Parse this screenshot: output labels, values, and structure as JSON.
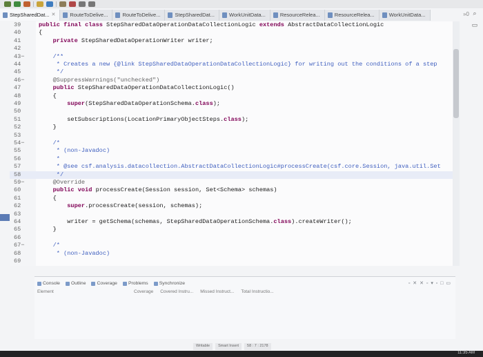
{
  "tabs": [
    {
      "label": "StepSharedDat...",
      "active": true
    },
    {
      "label": "RouteToDelive..."
    },
    {
      "label": "RouteToDelive..."
    },
    {
      "label": "StepSharedDat..."
    },
    {
      "label": "WorkUnitData..."
    },
    {
      "label": "ResourceRelea..."
    },
    {
      "label": "ResourceRelea..."
    },
    {
      "label": "WorkUnitData..."
    }
  ],
  "tabs_overflow": "»0",
  "code_lines": [
    {
      "num": "39",
      "text": "public final class StepSharedDataOperationDataCollectionLogic extends AbstractDataCollectionLogic"
    },
    {
      "num": "40",
      "text": "{"
    },
    {
      "num": "41",
      "text": "    private StepSharedDataOperationWriter writer;"
    },
    {
      "num": "42",
      "text": ""
    },
    {
      "num": "43−",
      "text": "    /**"
    },
    {
      "num": "44",
      "text": "     * Creates a new {@link StepSharedDataOperationDataCollectionLogic} for writing out the conditions of a step"
    },
    {
      "num": "45",
      "text": "     */"
    },
    {
      "num": "46−",
      "text": "    @SuppressWarnings(\"unchecked\")"
    },
    {
      "num": "47",
      "text": "    public StepSharedDataOperationDataCollectionLogic()"
    },
    {
      "num": "48",
      "text": "    {"
    },
    {
      "num": "49",
      "text": "        super(StepSharedDataOperationSchema.class);"
    },
    {
      "num": "50",
      "text": ""
    },
    {
      "num": "51",
      "text": "        setSubscriptions(LocationPrimaryObjectSteps.class);"
    },
    {
      "num": "52",
      "text": "    }"
    },
    {
      "num": "53",
      "text": ""
    },
    {
      "num": "54−",
      "text": "    /*"
    },
    {
      "num": "55",
      "text": "     * (non-Javadoc)"
    },
    {
      "num": "56",
      "text": "     *"
    },
    {
      "num": "57",
      "text": "     * @see csf.analysis.datacollection.AbstractDataCollectionLogic#processCreate(csf.core.Session, java.util.Set"
    },
    {
      "num": "58",
      "text": "     */"
    },
    {
      "num": "59−",
      "text": "    @Override"
    },
    {
      "num": "60",
      "text": "    public void processCreate(Session session, Set<Schema> schemas)"
    },
    {
      "num": "61",
      "text": "    {"
    },
    {
      "num": "62",
      "text": "        super.processCreate(session, schemas);"
    },
    {
      "num": "63",
      "text": ""
    },
    {
      "num": "64",
      "text": "        writer = getSchema(schemas, StepSharedDataOperationSchema.class).createWriter();"
    },
    {
      "num": "65",
      "text": "    }"
    },
    {
      "num": "66",
      "text": ""
    },
    {
      "num": "67−",
      "text": "    /*"
    },
    {
      "num": "68",
      "text": "     * (non-Javadoc)"
    },
    {
      "num": "69",
      "text": ""
    }
  ],
  "panel": {
    "tabs": [
      "Console",
      "Outline",
      "Coverage",
      "Problems",
      "Synchronize"
    ],
    "element_col": "Element",
    "columns": [
      "Coverage",
      "Covered Instru...",
      "Missed Instruct...",
      "Total Instructio..."
    ]
  },
  "status": {
    "mode": "Writable",
    "insert": "Smart Insert",
    "position": "58 : 7 : 2178"
  },
  "clock": "11:35 AM",
  "colors": {
    "keyword": "#7f0055",
    "comment": "#3f5fbf",
    "annotation": "#646464"
  }
}
